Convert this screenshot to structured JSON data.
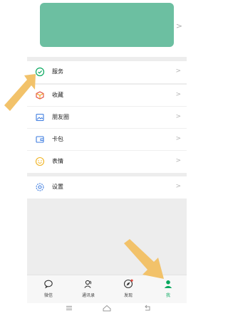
{
  "menu": {
    "group1": [
      {
        "label": "服务",
        "icon": "check-circle-icon"
      }
    ],
    "group2": [
      {
        "label": "收藏",
        "icon": "cube-icon"
      },
      {
        "label": "朋友圈",
        "icon": "image-icon"
      },
      {
        "label": "卡包",
        "icon": "wallet-icon"
      },
      {
        "label": "表情",
        "icon": "smiley-icon"
      }
    ],
    "group3": [
      {
        "label": "设置",
        "icon": "gear-icon"
      }
    ],
    "chevron": ">"
  },
  "tabbar": {
    "tabs": [
      {
        "label": "微信",
        "icon": "chat-bubble-icon"
      },
      {
        "label": "通讯录",
        "icon": "contacts-icon"
      },
      {
        "label": "发现",
        "icon": "compass-icon"
      },
      {
        "label": "我",
        "icon": "person-icon"
      }
    ],
    "active_index": 3
  },
  "colors": {
    "accent": "#07a85e",
    "annotation_arrow": "#f2c26a",
    "profile_blur": "#6cbfa1"
  }
}
